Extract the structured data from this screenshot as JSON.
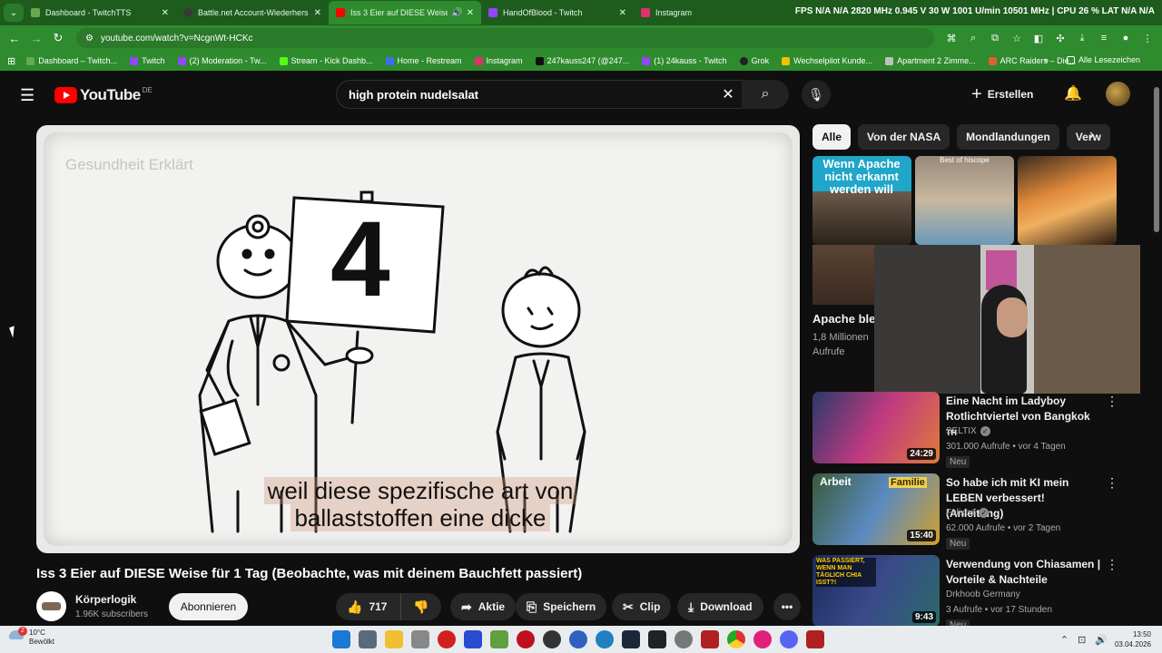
{
  "browser": {
    "tabs": [
      {
        "title": "Dashboard - TwitchTTS",
        "active": false,
        "color": "#6aa84f"
      },
      {
        "title": "Battle.net Account-Wiederhers",
        "active": false,
        "color": "#3a3a3a"
      },
      {
        "title": "Iss 3 Eier auf DIESE Weise fü",
        "active": true,
        "color": "#ff0000"
      },
      {
        "title": "HandOfBlood - Twitch",
        "active": false,
        "color": "#9146ff"
      },
      {
        "title": "Instagram",
        "active": false,
        "color": "#e1306c"
      }
    ],
    "overlay_stats": "FPS N/A  N/A  2820 MHz  0.945 V  30 W  1001 U/min  10501 MHz | CPU 26 %  LAT N/A  N/A",
    "url": "youtube.com/watch?v=NcgnWt-HCKc",
    "bookmarks": [
      {
        "label": "Dashboard – Twitch...",
        "color": "#6aa84f"
      },
      {
        "label": "Twitch",
        "color": "#9146ff"
      },
      {
        "label": "(2) Moderation - Tw...",
        "color": "#9146ff"
      },
      {
        "label": "Stream - Kick Dashb...",
        "color": "#53fc18"
      },
      {
        "label": "Home - Restream",
        "color": "#3b6ef5"
      },
      {
        "label": "Instagram",
        "color": "#e1306c"
      },
      {
        "label": "247kauss247 (@247...",
        "color": "#111111"
      },
      {
        "label": "(1) 24kauss - Twitch",
        "color": "#9146ff"
      },
      {
        "label": "Grok",
        "color": "#222222"
      },
      {
        "label": "Wechselpilot Kunde...",
        "color": "#f2c200"
      },
      {
        "label": "Apartment 2 Zimme...",
        "color": "#c0c0c0"
      },
      {
        "label": "ARC Raiders – Die...",
        "color": "#e06030"
      }
    ],
    "bookmarks_all": "Alle Lesezeichen"
  },
  "youtube": {
    "logo": "YouTube",
    "country": "DE",
    "search_query": "high protein nudelsalat",
    "create_label": "Erstellen"
  },
  "video": {
    "watermark": "Gesundheit Erklärt",
    "caption_line1": "weil diese spezifische art von",
    "caption_line2": "ballaststoffen eine dicke",
    "sign_number": "4",
    "title": "Iss 3 Eier auf DIESE Weise für 1 Tag (Beobachte, was mit deinem Bauchfett passiert)",
    "channel": "Körperlogik",
    "subscribers": "1.96K subscribers",
    "subscribe_label": "Abonnieren",
    "likes": "717",
    "share_label": "Aktie",
    "save_label": "Speichern",
    "clip_label": "Clip",
    "download_label": "Download"
  },
  "chips": [
    "Alle",
    "Von der NASA",
    "Mondlandungen",
    "Verw"
  ],
  "row1": {
    "thumb1_text": "Wenn Apache nicht erkannt werden will",
    "thumb2_text": "Best of hiscope",
    "left_title": "Apache bleibt nicht",
    "left_meta1": "1,8 Millionen",
    "left_meta2": "Aufrufe"
  },
  "recommendations": [
    {
      "title": "Eine Nacht im Ladyboy Rotlichtviertel von Bangkok",
      "title_suffix": "TH",
      "channel": "SELTIX",
      "meta": "301.000 Aufrufe • vor 4 Tagen",
      "badge": "Neu",
      "duration": "24:29"
    },
    {
      "title": "So habe ich mit KI mein LEBEN verbessert! (Anleitung)",
      "channel": "Felixba",
      "meta": "62.000 Aufrufe • vor 2 Tagen",
      "badge": "Neu",
      "duration": "15:40",
      "thumb_label1": "Arbeit",
      "thumb_label2": "Familie"
    },
    {
      "title": "Verwendung von Chiasamen | Vorteile & Nachteile",
      "channel": "Drkhoob Germany",
      "meta": "3 Aufrufe • vor 17 Stunden",
      "badge": "Neu",
      "duration": "9:43",
      "thumb_label1": "WAS PASSIERT, WENN MAN TÄGLICH CHIA ISST?!"
    }
  ],
  "taskbar": {
    "temperature": "10°C",
    "weather": "Bewölkt",
    "notification_count": "2",
    "time": "13:50",
    "date": "03.04.2026"
  }
}
